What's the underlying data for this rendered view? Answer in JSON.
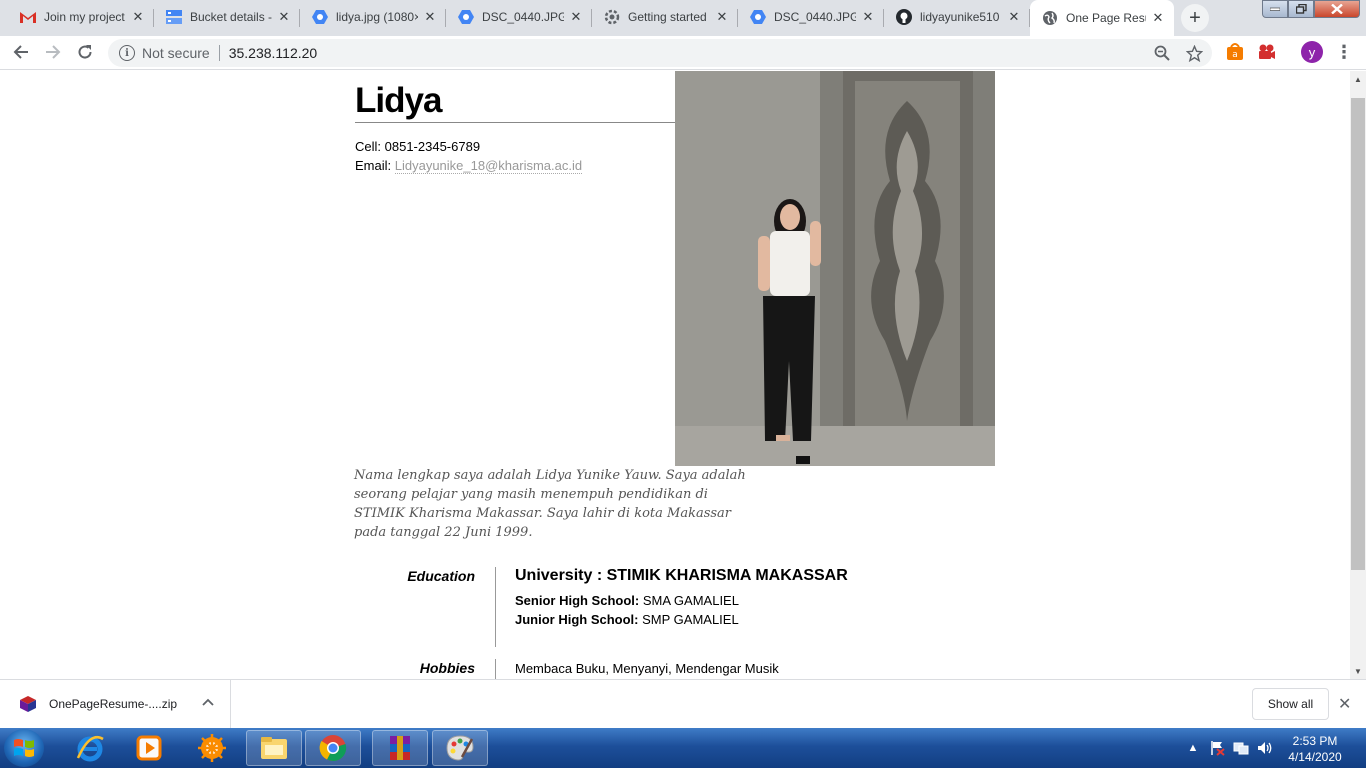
{
  "browser": {
    "tabs": [
      {
        "title": "Join my project",
        "icon": "gmail-icon"
      },
      {
        "title": "Bucket details -",
        "icon": "gcp-storage-icon"
      },
      {
        "title": "lidya.jpg (1080×",
        "icon": "gcp-icon"
      },
      {
        "title": "DSC_0440.JPG (",
        "icon": "gcp-icon"
      },
      {
        "title": "Getting started",
        "icon": "gear-icon"
      },
      {
        "title": "DSC_0440.JPG (",
        "icon": "gcp-icon"
      },
      {
        "title": "lidyayunike510",
        "icon": "github-icon"
      },
      {
        "title": "One Page Resu",
        "icon": "globe-icon",
        "active": true
      }
    ],
    "address": {
      "security_label": "Not secure",
      "url": "35.238.112.20"
    },
    "profile_initial": "y"
  },
  "resume": {
    "name": "Lidya",
    "cell_label": "Cell:",
    "cell": "0851-2345-6789",
    "email_label": "Email:",
    "email": "Lidyayunike_18@kharisma.ac.id",
    "bio": "Nama lengkap saya adalah Lidya Yunike Yauw. Saya adalah seorang pelajar yang masih menempuh pendidikan di STIMIK Kharisma Makassar. Saya lahir di kota Makassar pada tanggal 22 Juni 1999.",
    "education": {
      "label": "Education",
      "university": "University : STIMIK KHARISMA MAKASSAR",
      "senior_label": "Senior High School:",
      "senior": "SMA GAMALIEL",
      "junior_label": "Junior High School:",
      "junior": "SMP GAMALIEL"
    },
    "hobbies": {
      "label": "Hobbies",
      "text": "Membaca Buku, Menyanyi, Mendengar Musik"
    }
  },
  "downloads": {
    "file_name": "OnePageResume-....zip",
    "show_all": "Show all"
  },
  "taskbar": {
    "time": "2:53 PM",
    "date": "4/14/2020"
  }
}
